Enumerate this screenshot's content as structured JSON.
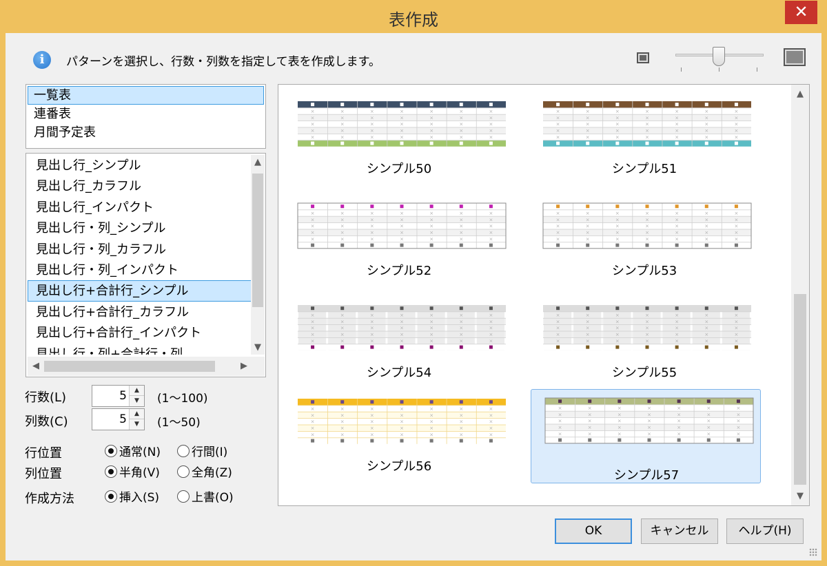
{
  "window": {
    "title": "表作成",
    "close_glyph": "✕"
  },
  "info": {
    "text": "パターンを選択し、行数・列数を指定して表を作成します。"
  },
  "categories": [
    "一覧表",
    "連番表",
    "月間予定表"
  ],
  "patterns": [
    "見出し行_シンプル",
    "見出し行_カラフル",
    "見出し行_インパクト",
    "見出し行・列_シンプル",
    "見出し行・列_カラフル",
    "見出し行・列_インパクト",
    "見出し行+合計行_シンプル",
    "見出し行+合計行_カラフル",
    "見出し行+合計行_インパクト",
    "見出し行・列+合計行・列"
  ],
  "rows": {
    "label": "行数(L)",
    "value": "5",
    "range": "(1〜100)"
  },
  "cols": {
    "label": "列数(C)",
    "value": "5",
    "range": "(1〜50)"
  },
  "row_position": {
    "label": "行位置",
    "options": [
      "通常(N)",
      "行間(I)"
    ],
    "selected": 0
  },
  "col_position": {
    "label": "列位置",
    "options": [
      "半角(V)",
      "全角(Z)"
    ],
    "selected": 0
  },
  "method": {
    "label": "作成方法",
    "options": [
      "挿入(S)",
      "上書(O)"
    ],
    "selected": 0
  },
  "previews": [
    {
      "label": "シンプル50",
      "style": "solid",
      "header": "#3d5068",
      "footer": "#a1c66b",
      "marker": "#ffffff"
    },
    {
      "label": "シンプル51",
      "style": "solid",
      "header": "#7a5330",
      "footer": "#5bbcc4",
      "marker": "#ffffff"
    },
    {
      "label": "シンプル52",
      "style": "outline",
      "header": "#ffffff",
      "footer": "#ffffff",
      "marker": "#c020b0"
    },
    {
      "label": "シンプル53",
      "style": "outline",
      "header": "#ffffff",
      "footer": "#ffffff",
      "marker": "#e0962a"
    },
    {
      "label": "シンプル54",
      "style": "banded",
      "header": "#dcdcdc",
      "footer": "#ffffff",
      "marker": "#555555",
      "footer_marker": "#8a1070"
    },
    {
      "label": "シンプル55",
      "style": "banded",
      "header": "#dcdcdc",
      "footer": "#ffffff",
      "marker": "#555555",
      "footer_marker": "#7a5a20"
    },
    {
      "label": "シンプル56",
      "style": "light",
      "header": "#f5bb22",
      "footer": "#ffffff",
      "marker": "#6a4a8a"
    },
    {
      "label": "シンプル57",
      "style": "plain",
      "header": "#b4bd84",
      "footer": "#ffffff",
      "marker": "#553355"
    }
  ],
  "buttons": {
    "ok": "OK",
    "cancel": "キャンセル",
    "help": "ヘルプ(H)"
  }
}
